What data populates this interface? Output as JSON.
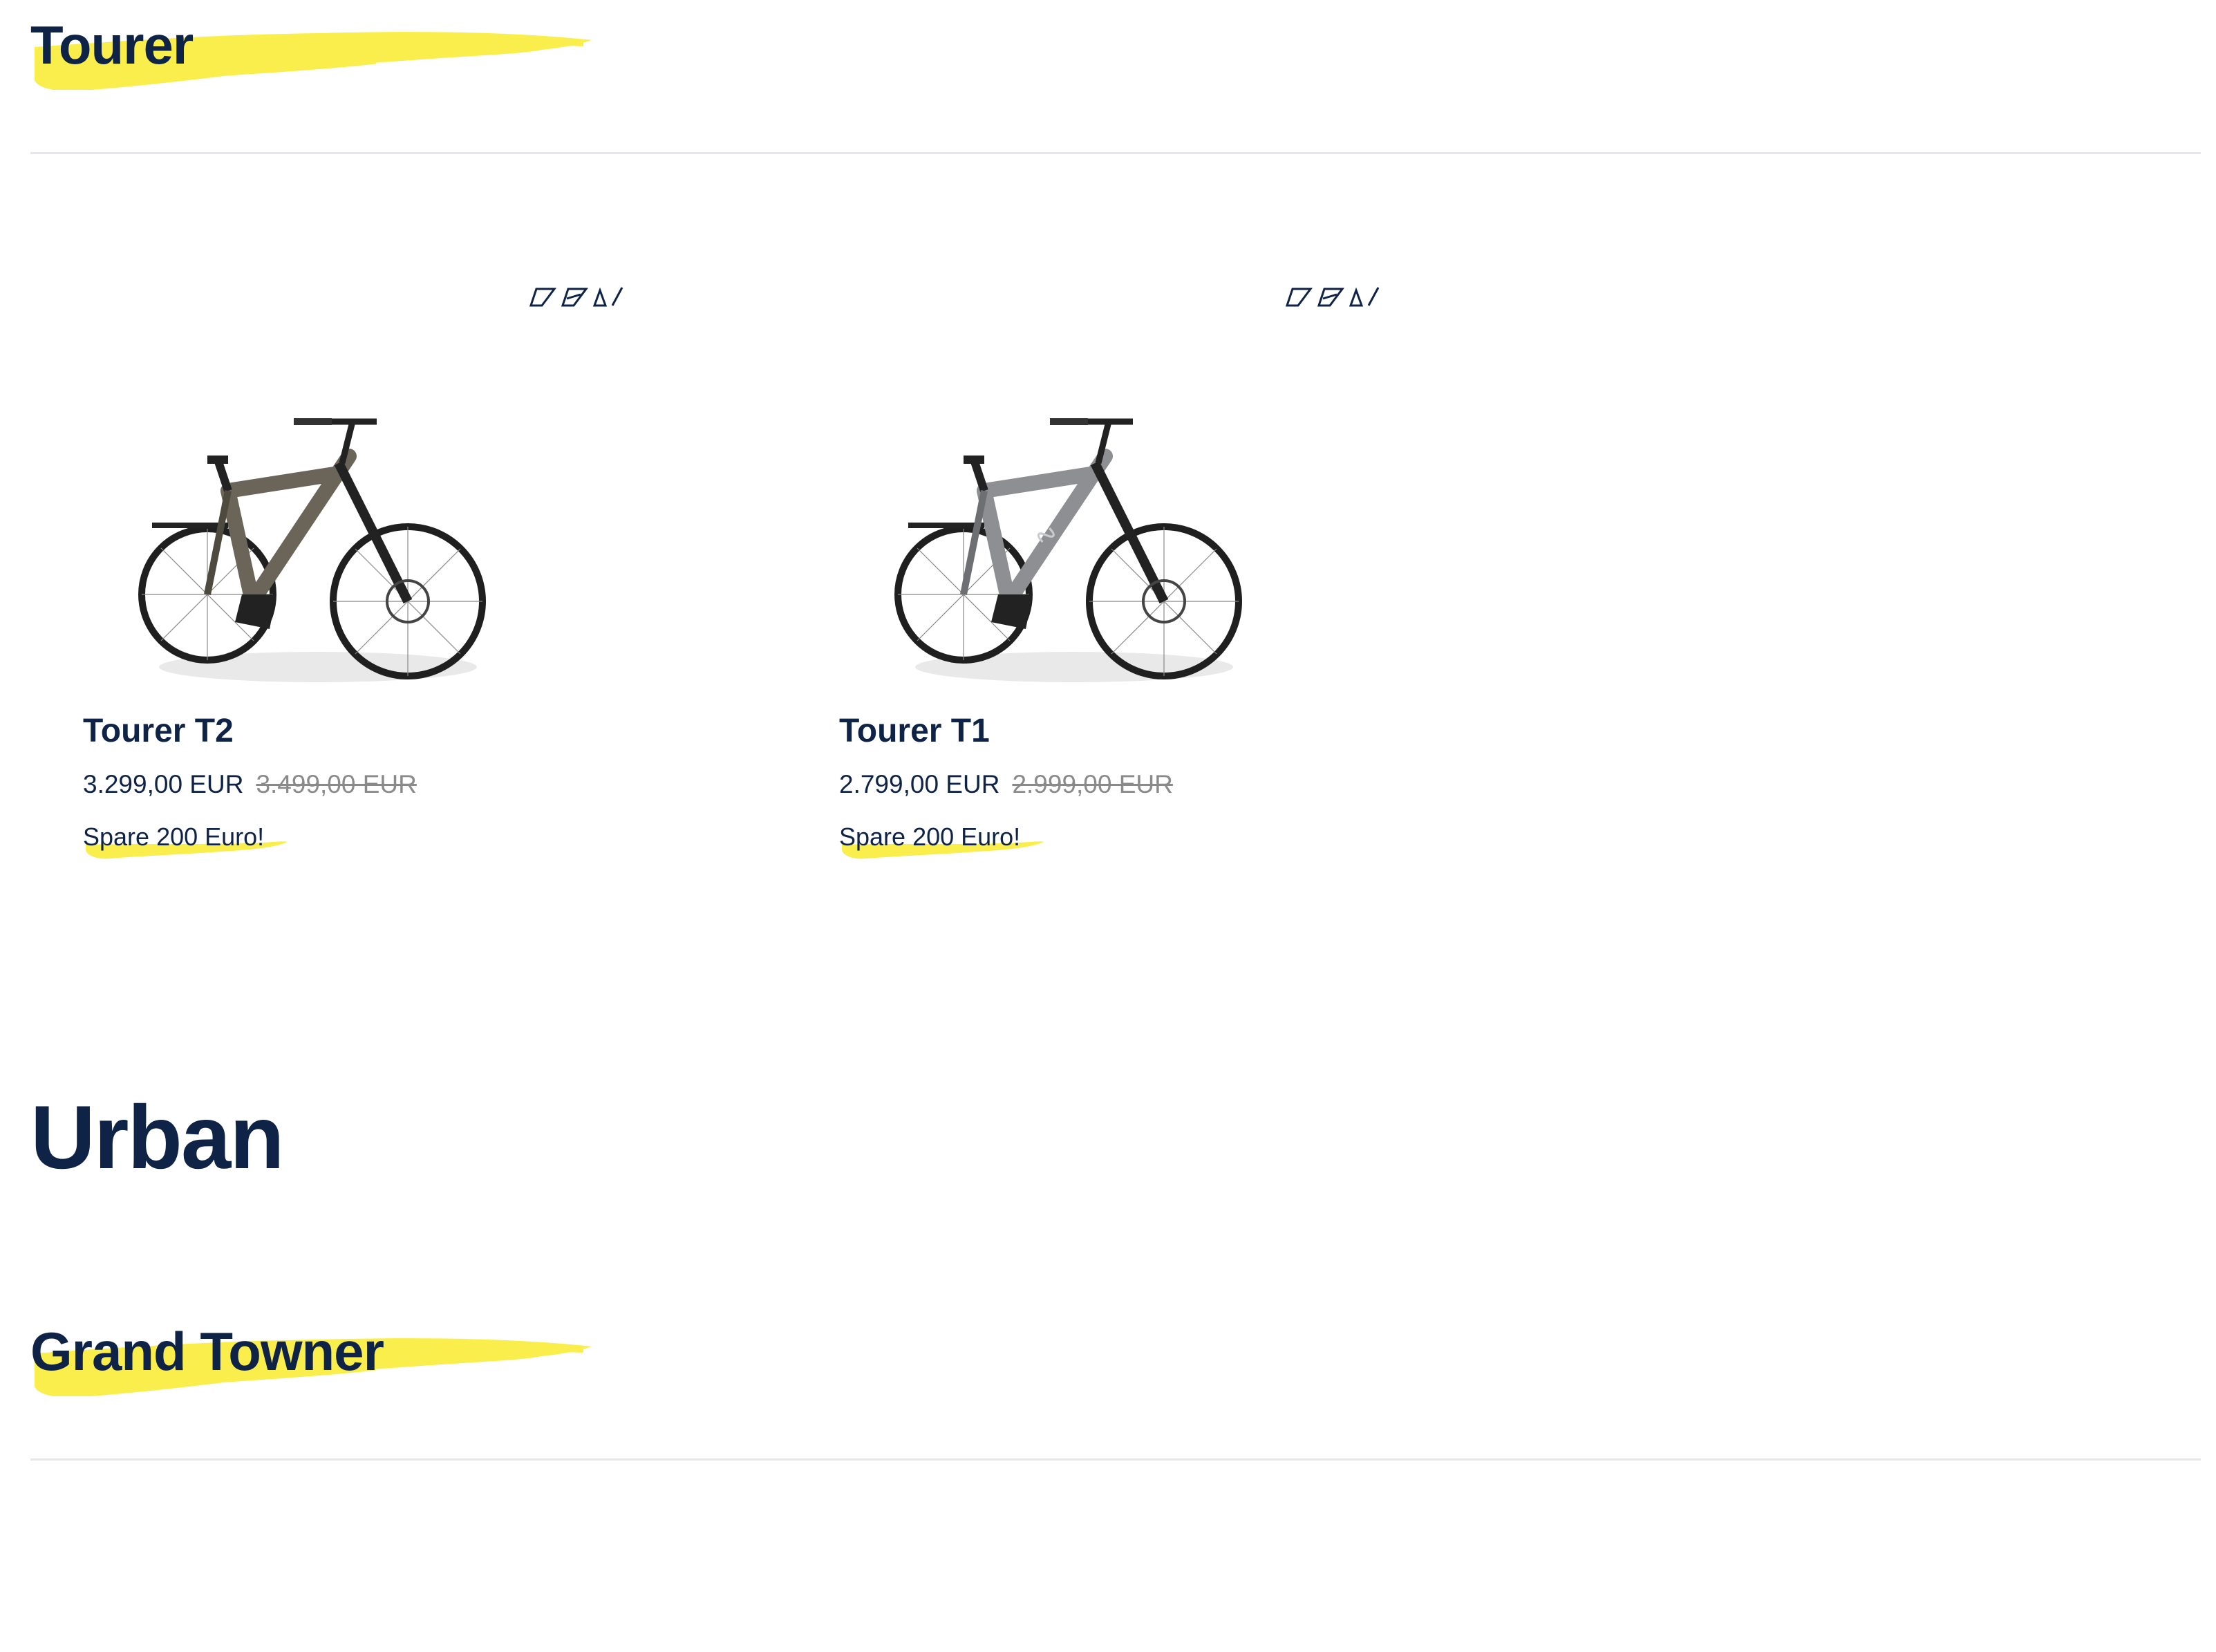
{
  "sections": [
    {
      "heading": "Tourer",
      "products": [
        {
          "name": "Tourer T2",
          "price": "3.299,00 EUR",
          "old_price": "3.499,00 EUR",
          "promo": "Spare 200 Euro!",
          "frame_color": "#6b6458"
        },
        {
          "name": "Tourer T1",
          "price": "2.799,00 EUR",
          "old_price": "2.999,00 EUR",
          "promo": "Spare 200 Euro!",
          "frame_color": "#8d8f93"
        }
      ]
    },
    {
      "category": "Urban",
      "heading": "Grand Towner"
    }
  ],
  "colors": {
    "navy": "#0f2347",
    "brush_yellow": "#f9ee4b",
    "divider": "#e6e7ea",
    "old_price_grey": "#8a8a8a"
  },
  "icons": {
    "frame_types": "frame-types-icon",
    "bike_image": "e-bike-image"
  }
}
